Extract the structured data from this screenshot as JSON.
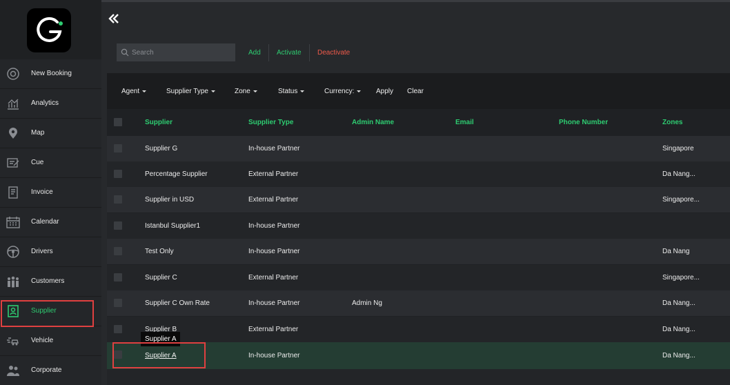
{
  "sidebar": {
    "items": [
      {
        "label": "New Booking",
        "icon": "plus-circle-icon"
      },
      {
        "label": "Analytics",
        "icon": "analytics-icon"
      },
      {
        "label": "Map",
        "icon": "map-pin-icon"
      },
      {
        "label": "Cue",
        "icon": "cue-icon"
      },
      {
        "label": "Invoice",
        "icon": "invoice-icon"
      },
      {
        "label": "Calendar",
        "icon": "calendar-icon"
      },
      {
        "label": "Drivers",
        "icon": "steering-wheel-icon"
      },
      {
        "label": "Customers",
        "icon": "customers-icon"
      },
      {
        "label": "Supplier",
        "icon": "supplier-icon",
        "active": true
      },
      {
        "label": "Vehicle",
        "icon": "vehicle-icon"
      },
      {
        "label": "Corporate",
        "icon": "corporate-icon"
      }
    ]
  },
  "toolbar": {
    "search_placeholder": "Search",
    "add_label": "Add",
    "activate_label": "Activate",
    "deactivate_label": "Deactivate"
  },
  "filters": {
    "agent": "Agent",
    "supplier_type": "Supplier Type",
    "zone": "Zone",
    "status": "Status",
    "currency": "Currency:",
    "apply": "Apply",
    "clear": "Clear"
  },
  "table": {
    "headers": {
      "supplier": "Supplier",
      "supplier_type": "Supplier Type",
      "admin_name": "Admin Name",
      "email": "Email",
      "phone_number": "Phone Number",
      "zones": "Zones"
    },
    "rows": [
      {
        "supplier": "Supplier G",
        "type": "In-house Partner",
        "admin": "",
        "email": "",
        "phone": "",
        "zones": "Singapore"
      },
      {
        "supplier": "Percentage Supplier",
        "type": "External Partner",
        "admin": "",
        "email": "",
        "phone": "",
        "zones": "Da Nang..."
      },
      {
        "supplier": "Supplier in USD",
        "type": "External Partner",
        "admin": "",
        "email": "",
        "phone": "",
        "zones": "Singapore..."
      },
      {
        "supplier": "Istanbul Supplier1",
        "type": "In-house Partner",
        "admin": "",
        "email": "",
        "phone": "",
        "zones": ""
      },
      {
        "supplier": "Test Only",
        "type": "In-house Partner",
        "admin": "",
        "email": "",
        "phone": "",
        "zones": "Da Nang"
      },
      {
        "supplier": "Supplier C",
        "type": "External Partner",
        "admin": "",
        "email": "",
        "phone": "",
        "zones": "Singapore..."
      },
      {
        "supplier": "Supplier C Own Rate",
        "type": "In-house Partner",
        "admin": "Admin Ng",
        "email": "",
        "phone": "",
        "zones": "Da Nang..."
      },
      {
        "supplier": "Supplier B",
        "type": "External Partner",
        "admin": "",
        "email": "",
        "phone": "",
        "zones": "Da Nang..."
      },
      {
        "supplier": "Supplier A",
        "type": "In-house Partner",
        "admin": "",
        "email": "",
        "phone": "",
        "zones": "Da Nang..."
      }
    ]
  },
  "tooltip": "Supplier A",
  "colors": {
    "accent": "#2ecc71",
    "danger": "#ef5a4a",
    "highlight": "#e04040"
  }
}
